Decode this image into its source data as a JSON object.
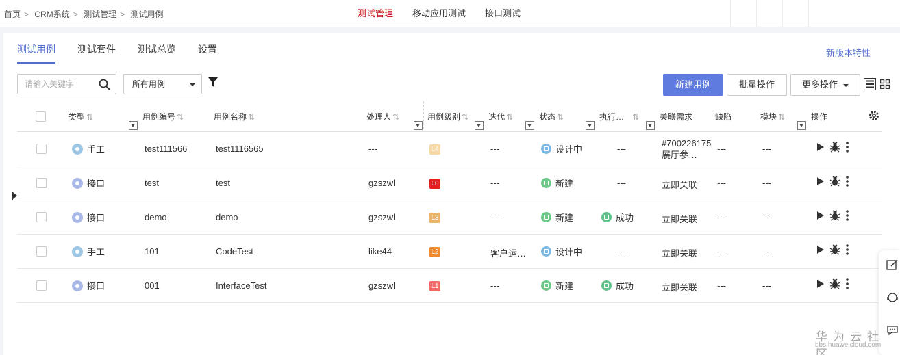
{
  "breadcrumb": [
    "首页",
    "CRM系统",
    "测试管理",
    "测试用例"
  ],
  "breadcrumb_separator": ">",
  "top_nav": [
    {
      "label": "测试管理",
      "active": true
    },
    {
      "label": "移动应用测试",
      "active": false
    },
    {
      "label": "接口测试",
      "active": false
    }
  ],
  "sub_tabs": [
    {
      "label": "测试用例",
      "active": true
    },
    {
      "label": "测试套件",
      "active": false
    },
    {
      "label": "测试总览",
      "active": false
    },
    {
      "label": "设置",
      "active": false
    }
  ],
  "new_features_link": "新版本特性",
  "search": {
    "placeholder": "请输入关键字",
    "icon": "search-icon"
  },
  "case_filter": {
    "selected": "所有用例"
  },
  "buttons": {
    "new_case": "新建用例",
    "batch": "批量操作",
    "more": "更多操作"
  },
  "columns": {
    "type": "类型",
    "id": "用例编号",
    "name": "用例名称",
    "assignee": "处理人",
    "level": "用例级别",
    "iteration": "迭代",
    "status": "状态",
    "execution": "执行…",
    "requirement": "关联需求",
    "defect": "缺陷",
    "module": "模块",
    "actions": "操作"
  },
  "rows": [
    {
      "type": "手工",
      "type_kind": "manual",
      "id": "test111566",
      "name": "test1116565",
      "assignee": "---",
      "level": "L4",
      "level_color": "#f6d9a6",
      "iteration": "---",
      "status": "设计中",
      "status_color": "#7fb8e0",
      "execution": "---",
      "exec_ok": false,
      "requirement": [
        "#700226175",
        "展厅参…"
      ],
      "defect": "---",
      "module": "---"
    },
    {
      "type": "接口",
      "type_kind": "api",
      "id": "test",
      "name": "test",
      "assignee": "gzszwl",
      "level": "L0",
      "level_color": "#e02020",
      "iteration": "---",
      "status": "新建",
      "status_color": "#6cc98a",
      "execution": "---",
      "exec_ok": false,
      "requirement": [
        "立即关联"
      ],
      "defect": "---",
      "module": "---"
    },
    {
      "type": "接口",
      "type_kind": "api",
      "id": "demo",
      "name": "demo",
      "assignee": "gzszwl",
      "level": "L3",
      "level_color": "#eab56a",
      "iteration": "---",
      "status": "新建",
      "status_color": "#6cc98a",
      "execution": "成功",
      "exec_ok": true,
      "requirement": [
        "立即关联"
      ],
      "defect": "---",
      "module": "---"
    },
    {
      "type": "手工",
      "type_kind": "manual",
      "id": "101",
      "name": "CodeTest",
      "assignee": "like44",
      "level": "L2",
      "level_color": "#f08a2e",
      "iteration": "客户运…",
      "status": "设计中",
      "status_color": "#7fb8e0",
      "execution": "---",
      "exec_ok": false,
      "requirement": [
        "立即关联"
      ],
      "defect": "---",
      "module": "---"
    },
    {
      "type": "接口",
      "type_kind": "api",
      "id": "001",
      "name": "InterfaceTest",
      "assignee": "gzszwl",
      "level": "L1",
      "level_color": "#f26b6b",
      "iteration": "---",
      "status": "新建",
      "status_color": "#6cc98a",
      "execution": "成功",
      "exec_ok": true,
      "requirement": [
        "立即关联"
      ],
      "defect": "---",
      "module": "---"
    }
  ],
  "exec_ok_color": "#5fc28a",
  "accent_color": "#5e7ce0",
  "brand_red": "#c7000b",
  "watermark": {
    "title": "华为云社区",
    "url": "bbs.huaweicloud.com"
  }
}
